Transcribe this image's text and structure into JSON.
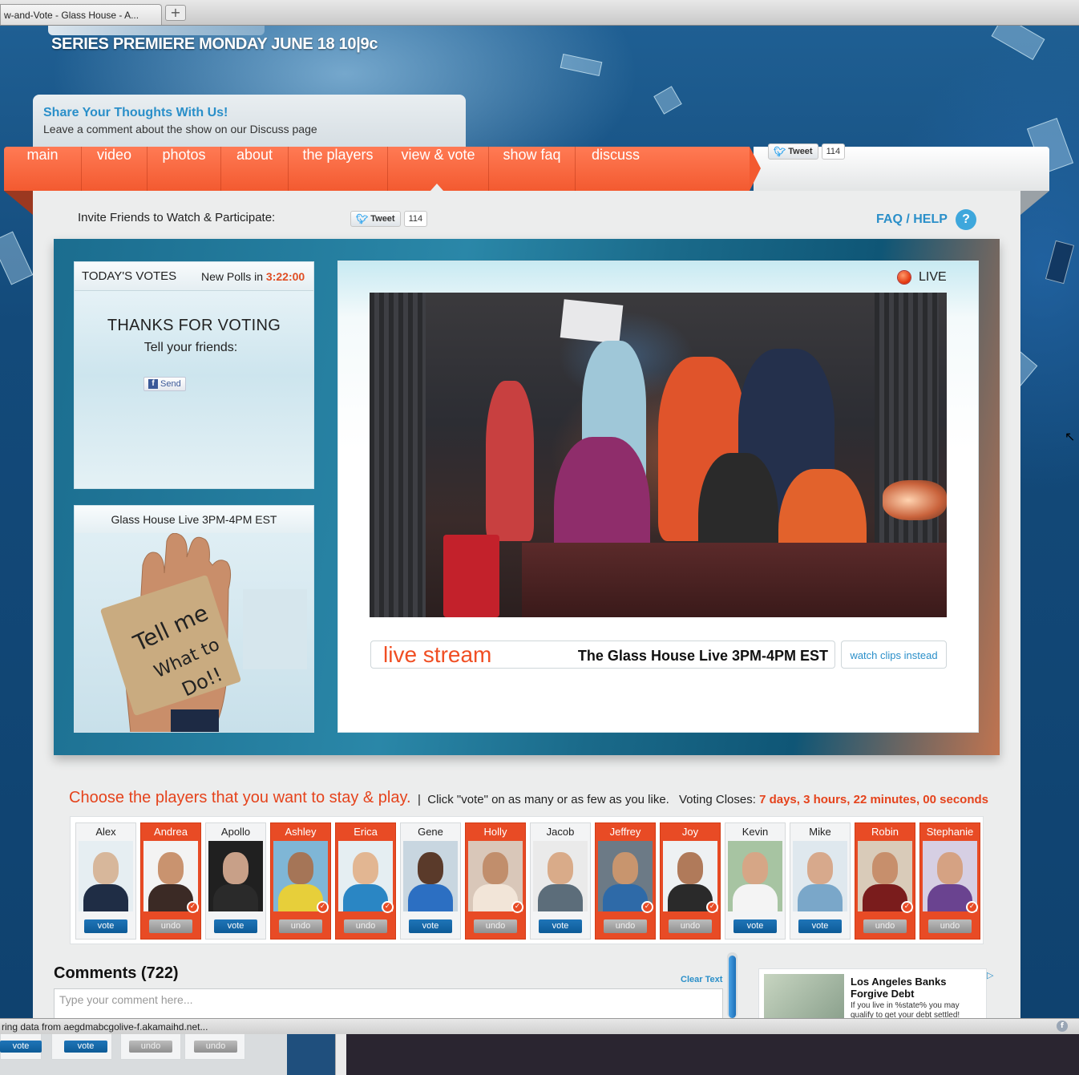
{
  "browser": {
    "tab_title": "w-and-Vote - Glass House - A...",
    "new_tab_symbol": "+",
    "status_text": "ring data from aegdmabcgolive-f.akamaihd.net...",
    "status_icon_glyph": "f"
  },
  "header": {
    "premiere": "SERIES PREMIERE MONDAY JUNE 18 10|9c"
  },
  "share": {
    "heading": "Share Your Thoughts With Us!",
    "subtext": "Leave a comment about the show on our Discuss page"
  },
  "nav": {
    "items": [
      {
        "label": "main"
      },
      {
        "label": "video"
      },
      {
        "label": "photos"
      },
      {
        "label": "about"
      },
      {
        "label": "the players"
      },
      {
        "label": "view & vote"
      },
      {
        "label": "show faq"
      },
      {
        "label": "discuss"
      }
    ],
    "active": "view & vote"
  },
  "tweet": {
    "label": "Tweet",
    "count": "114"
  },
  "invite": {
    "label": "Invite Friends to Watch & Participate:"
  },
  "faq": {
    "label": "FAQ / HELP",
    "icon_glyph": "?"
  },
  "votes_panel": {
    "title": "TODAY'S VOTES",
    "new_polls_label": "New Polls in",
    "countdown": "3:22:00",
    "thanks": "THANKS FOR VOTING",
    "tell_friends": "Tell your friends:",
    "send_label": "Send",
    "fb_glyph": "f"
  },
  "promo_panel": {
    "title": "Glass House Live 3PM-4PM EST",
    "note_line1": "Tell me",
    "note_line2": "What to",
    "note_line3": "Do!!"
  },
  "player": {
    "live_label": "LIVE",
    "stream_label": "live stream",
    "stream_title": "The Glass House Live 3PM-4PM EST",
    "clips_button": "watch clips instead"
  },
  "voting": {
    "heading": "Choose the players that you want to stay & play.",
    "separator": "|",
    "instructions": "Click \"vote\" on as many or as few as you like.",
    "closes_label": "Voting Closes:",
    "closes_value": "7 days, 3 hours, 22 minutes, 00 seconds",
    "check_glyph": "✓",
    "players": [
      {
        "name": "Alex",
        "voted": false,
        "button": "vote"
      },
      {
        "name": "Andrea",
        "voted": true,
        "button": "undo"
      },
      {
        "name": "Apollo",
        "voted": false,
        "button": "vote"
      },
      {
        "name": "Ashley",
        "voted": true,
        "button": "undo"
      },
      {
        "name": "Erica",
        "voted": true,
        "button": "undo"
      },
      {
        "name": "Gene",
        "voted": false,
        "button": "vote"
      },
      {
        "name": "Holly",
        "voted": true,
        "button": "undo"
      },
      {
        "name": "Jacob",
        "voted": false,
        "button": "vote"
      },
      {
        "name": "Jeffrey",
        "voted": true,
        "button": "undo"
      },
      {
        "name": "Joy",
        "voted": true,
        "button": "undo"
      },
      {
        "name": "Kevin",
        "voted": false,
        "button": "vote"
      },
      {
        "name": "Mike",
        "voted": false,
        "button": "vote"
      },
      {
        "name": "Robin",
        "voted": true,
        "button": "undo"
      },
      {
        "name": "Stephanie",
        "voted": true,
        "button": "undo"
      }
    ]
  },
  "comments": {
    "heading": "Comments (722)",
    "clear_label": "Clear Text",
    "placeholder": "Type your comment here..."
  },
  "ad": {
    "title": "Los Angeles Banks Forgive Debt",
    "body": "If you live in %state% you may qualify to get your debt settled!",
    "choices_glyph": "▷"
  },
  "bottom_buttons": [
    {
      "label": "vote"
    },
    {
      "label": "vote"
    },
    {
      "label": "undo"
    },
    {
      "label": "undo"
    }
  ],
  "colors": {
    "accent_orange": "#f35a30",
    "link_blue": "#2a8fc9",
    "vote_blue": "#0d5b97",
    "undo_gray": "#8f8f8f"
  }
}
